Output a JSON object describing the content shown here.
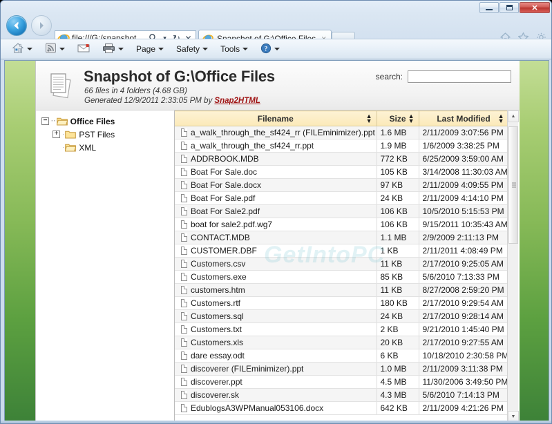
{
  "window": {
    "title": "Snapshot of G:\\Office Files",
    "minimize_label": "Minimize",
    "maximize_label": "Maximize",
    "close_label": "✕"
  },
  "nav": {
    "back_label": "Back",
    "forward_label": "Forward",
    "address_value": "file:///G:/snapshot.",
    "search_icon": "search-icon",
    "dropdown_icon": "▾",
    "refresh_icon": "↻",
    "stop_icon": "✕",
    "home_icon": "home-icon",
    "favorites_icon": "star-icon",
    "tools_icon": "gear-icon"
  },
  "tabs": [
    {
      "label": "Snapshot of G:\\Office Files",
      "close": "×",
      "active": true
    }
  ],
  "newtab_label": "",
  "commandbar": {
    "items": [
      {
        "name": "home-button",
        "icon": "home-icon",
        "label": "",
        "caret": true
      },
      {
        "name": "feeds-button",
        "icon": "rss-icon",
        "label": "",
        "caret": true
      },
      {
        "name": "mail-button",
        "icon": "mail-icon",
        "label": "",
        "caret": false
      },
      {
        "name": "print-button",
        "icon": "printer-icon",
        "label": "",
        "caret": true
      },
      {
        "name": "page-menu",
        "icon": "",
        "label": "Page",
        "caret": true
      },
      {
        "name": "safety-menu",
        "icon": "",
        "label": "Safety",
        "caret": true
      },
      {
        "name": "tools-menu",
        "icon": "",
        "label": "Tools",
        "caret": true
      },
      {
        "name": "help-menu",
        "icon": "help-icon",
        "label": "",
        "caret": true
      }
    ]
  },
  "document": {
    "title": "Snapshot of G:\\Office Files",
    "subtitle_files": "66 files in 4 folders (4.68 GB)",
    "generated_prefix": "Generated 12/9/2011 2:33:05 PM by ",
    "generated_link": "Snap2HTML",
    "search_label": "search:",
    "search_value": "",
    "search_placeholder": ""
  },
  "tree": {
    "items": [
      {
        "label": "Office Files",
        "level": 0,
        "expander": "−",
        "open": true
      },
      {
        "label": "PST Files",
        "level": 1,
        "expander": "+",
        "open": false
      },
      {
        "label": "XML",
        "level": 1,
        "expander": "",
        "open": true
      }
    ]
  },
  "table": {
    "columns": [
      {
        "key": "filename",
        "label": "Filename",
        "sort": "↕"
      },
      {
        "key": "size",
        "label": "Size",
        "sort": "↕"
      },
      {
        "key": "modified",
        "label": "Last Modified",
        "sort": "↕"
      }
    ],
    "rows": [
      {
        "filename": "a_walk_through_the_sf424_rr (FILEminimizer).ppt",
        "size": "1.6 MB",
        "modified": "2/11/2009 3:07:56 PM"
      },
      {
        "filename": "a_walk_through_the_sf424_rr.ppt",
        "size": "1.9 MB",
        "modified": "1/6/2009 3:38:25 PM"
      },
      {
        "filename": "ADDRBOOK.MDB",
        "size": "772 KB",
        "modified": "6/25/2009 3:59:00 AM"
      },
      {
        "filename": "Boat For Sale.doc",
        "size": "105 KB",
        "modified": "3/14/2008 11:30:03 AM"
      },
      {
        "filename": "Boat For Sale.docx",
        "size": "97 KB",
        "modified": "2/11/2009 4:09:55 PM"
      },
      {
        "filename": "Boat For Sale.pdf",
        "size": "24 KB",
        "modified": "2/11/2009 4:14:10 PM"
      },
      {
        "filename": "Boat For Sale2.pdf",
        "size": "106 KB",
        "modified": "10/5/2010 5:15:53 PM"
      },
      {
        "filename": "boat for sale2.pdf.wg7",
        "size": "106 KB",
        "modified": "9/15/2011 10:35:43 AM"
      },
      {
        "filename": "CONTACT.MDB",
        "size": "1.1 MB",
        "modified": "2/9/2009 2:11:13 PM"
      },
      {
        "filename": "CUSTOMER.DBF",
        "size": "1 KB",
        "modified": "2/11/2011 4:08:49 PM"
      },
      {
        "filename": "Customers.csv",
        "size": "11 KB",
        "modified": "2/17/2010 9:25:05 AM"
      },
      {
        "filename": "Customers.exe",
        "size": "85 KB",
        "modified": "5/6/2010 7:13:33 PM"
      },
      {
        "filename": "customers.htm",
        "size": "11 KB",
        "modified": "8/27/2008 2:59:20 PM"
      },
      {
        "filename": "Customers.rtf",
        "size": "180 KB",
        "modified": "2/17/2010 9:29:54 AM"
      },
      {
        "filename": "Customers.sql",
        "size": "24 KB",
        "modified": "2/17/2010 9:28:14 AM"
      },
      {
        "filename": "Customers.txt",
        "size": "2 KB",
        "modified": "9/21/2010 1:45:40 PM"
      },
      {
        "filename": "Customers.xls",
        "size": "20 KB",
        "modified": "2/17/2010 9:27:55 AM"
      },
      {
        "filename": "dare essay.odt",
        "size": "6 KB",
        "modified": "10/18/2010 2:30:58 PM"
      },
      {
        "filename": "discoverer (FILEminimizer).ppt",
        "size": "1.0 MB",
        "modified": "2/11/2009 3:11:38 PM"
      },
      {
        "filename": "discoverer.ppt",
        "size": "4.5 MB",
        "modified": "11/30/2006 3:49:50 PM"
      },
      {
        "filename": "discoverer.sk",
        "size": "4.3 MB",
        "modified": "5/6/2010 7:14:13 PM"
      },
      {
        "filename": "EdublogsA3WPManual053106.docx",
        "size": "642 KB",
        "modified": "2/11/2009 4:21:26 PM"
      }
    ]
  },
  "scrollbar": {
    "up_arrow": "▲",
    "down_arrow": "▼"
  },
  "watermark": "GetIntoPC",
  "colors": {
    "page_green_top": "#c3dd95",
    "page_green_bottom": "#3d8238",
    "header_amber": "#fbe9b8",
    "link_red": "#a01515",
    "close_red": "#b8352f"
  }
}
